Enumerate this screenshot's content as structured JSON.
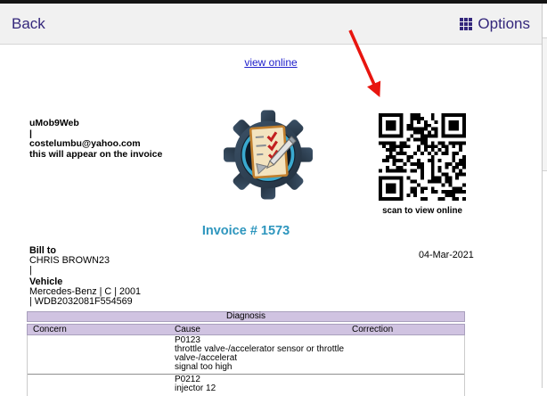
{
  "colors": {
    "accent": "#34277c",
    "link": "#2121cc",
    "invoice-accent": "#2e96be",
    "table-header-bg": "#d0c3e1",
    "arrow": "#e8150f",
    "header-bg": "#f1f1f1"
  },
  "header": {
    "back_label": "Back",
    "options_label": "Options"
  },
  "invoice": {
    "view_online_link": "view online",
    "sender": {
      "app_name": "uMob9Web",
      "separator": "|",
      "email": "costelumbu@yahoo.com",
      "note": "this will appear on the invoice"
    },
    "qr_caption": "scan to view online",
    "title": "Invoice # 1573",
    "bill_to": {
      "label": "Bill to",
      "name": "CHRIS BROWN23",
      "separator": "|"
    },
    "date": "04-Mar-2021",
    "vehicle": {
      "label": "Vehicle",
      "summary": "Mercedes-Benz | C | 2001",
      "vin_line": "| WDB2032081F554569"
    },
    "diagnosis_table": {
      "title": "Diagnosis",
      "columns": [
        "Concern",
        "Cause",
        "Correction"
      ],
      "rows": [
        {
          "concern": "",
          "cause": "P0123\nthrottle valve-/accelerator sensor or throttle\nvalve-/accelerat\nsignal too high",
          "correction": ""
        },
        {
          "concern": "",
          "cause": "P0212\ninjector 12",
          "correction": ""
        }
      ]
    }
  }
}
